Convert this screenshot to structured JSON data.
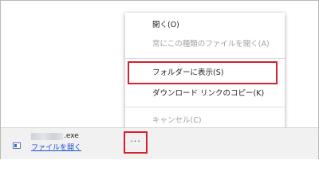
{
  "context_menu": {
    "items": [
      {
        "label": "開く(O)",
        "enabled": true
      },
      {
        "label": "常にこの種類のファイルを開く(A)",
        "enabled": false
      },
      {
        "label": "フォルダーに表示(S)",
        "enabled": true,
        "highlighted": true
      },
      {
        "label": "ダウンロード リンクのコピー(K)",
        "enabled": true
      },
      {
        "label": "キャンセル(C)",
        "enabled": false
      }
    ]
  },
  "download_bar": {
    "file_extension": ".exe",
    "open_link": "ファイルを開く",
    "more_button": "···"
  },
  "colors": {
    "highlight_border": "#d8202c",
    "link": "#1a4fd0",
    "disabled_text": "#a2a2a2"
  }
}
